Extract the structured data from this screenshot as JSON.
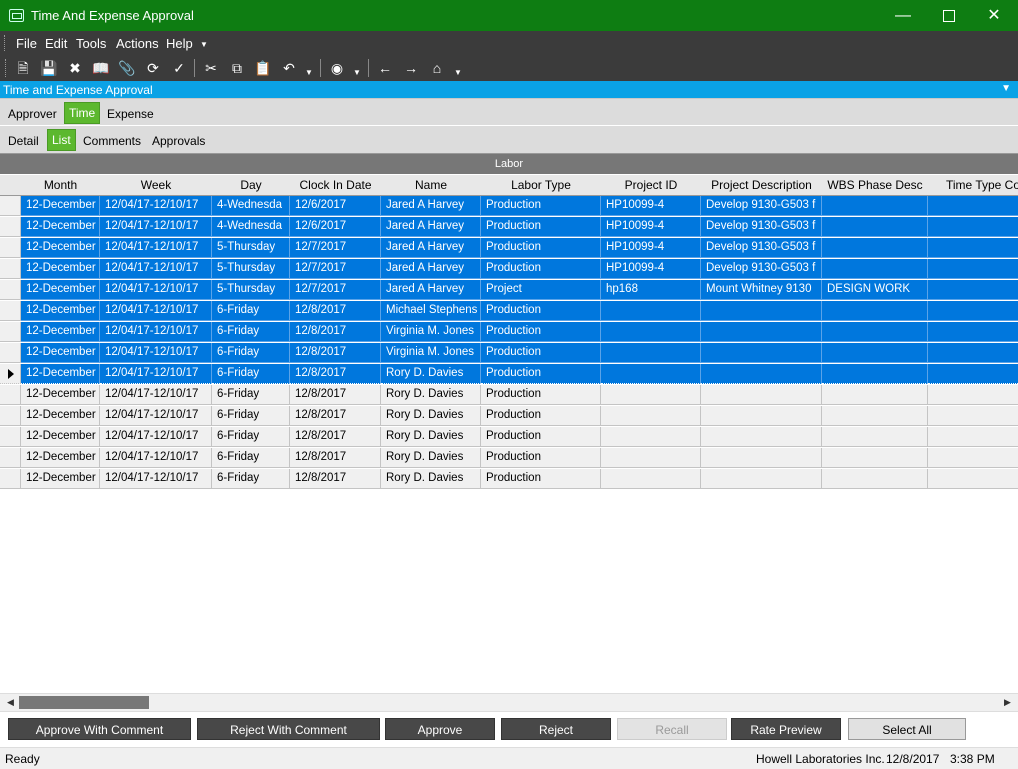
{
  "window": {
    "title": "Time And Expense Approval"
  },
  "menu": [
    "File",
    "Edit",
    "Tools",
    "Actions",
    "Help"
  ],
  "toolbar_icons": [
    "new-icon",
    "save-icon",
    "delete-icon",
    "book-icon",
    "attach-icon",
    "refresh-icon",
    "clear-icon",
    "cut-icon",
    "copy-icon",
    "paste-icon",
    "undo-icon",
    "binoculars-icon",
    "back-icon",
    "forward-icon",
    "home-icon"
  ],
  "doc_title": "Time and Expense Approval",
  "tabs_top": [
    "Approver",
    "Time",
    "Expense"
  ],
  "tabs_sub": [
    "Detail",
    "List",
    "Comments",
    "Approvals"
  ],
  "grid": {
    "group_header": "Labor",
    "columns": [
      "Month",
      "Week",
      "Day",
      "Clock In Date",
      "Name",
      "Labor Type",
      "Project ID",
      "Project Description",
      "WBS Phase Desc",
      "Time Type Co"
    ],
    "rows": [
      {
        "selected": true,
        "cells": [
          "12-December",
          "12/04/17-12/10/17",
          "4-Wednesda",
          "12/6/2017",
          "Jared A Harvey",
          "Production",
          "HP10099-4",
          "Develop 9130-G503 f",
          ""
        ]
      },
      {
        "selected": true,
        "cells": [
          "12-December",
          "12/04/17-12/10/17",
          "4-Wednesda",
          "12/6/2017",
          "Jared A Harvey",
          "Production",
          "HP10099-4",
          "Develop 9130-G503 f",
          ""
        ]
      },
      {
        "selected": true,
        "cells": [
          "12-December",
          "12/04/17-12/10/17",
          "5-Thursday",
          "12/7/2017",
          "Jared A Harvey",
          "Production",
          "HP10099-4",
          "Develop 9130-G503 f",
          ""
        ]
      },
      {
        "selected": true,
        "cells": [
          "12-December",
          "12/04/17-12/10/17",
          "5-Thursday",
          "12/7/2017",
          "Jared A Harvey",
          "Production",
          "HP10099-4",
          "Develop 9130-G503 f",
          ""
        ]
      },
      {
        "selected": true,
        "cells": [
          "12-December",
          "12/04/17-12/10/17",
          "5-Thursday",
          "12/7/2017",
          "Jared A Harvey",
          "Project",
          "hp168",
          "Mount Whitney 9130",
          "DESIGN WORK"
        ]
      },
      {
        "selected": true,
        "cells": [
          "12-December",
          "12/04/17-12/10/17",
          "6-Friday",
          "12/8/2017",
          "Michael Stephens",
          "Production",
          "",
          "",
          ""
        ]
      },
      {
        "selected": true,
        "cells": [
          "12-December",
          "12/04/17-12/10/17",
          "6-Friday",
          "12/8/2017",
          "Virginia M. Jones",
          "Production",
          "",
          "",
          ""
        ]
      },
      {
        "selected": true,
        "cells": [
          "12-December",
          "12/04/17-12/10/17",
          "6-Friday",
          "12/8/2017",
          "Virginia M. Jones",
          "Production",
          "",
          "",
          ""
        ]
      },
      {
        "selected": true,
        "current": true,
        "cells": [
          "12-December",
          "12/04/17-12/10/17",
          "6-Friday",
          "12/8/2017",
          "Rory D. Davies",
          "Production",
          "",
          "",
          ""
        ]
      },
      {
        "selected": false,
        "cells": [
          "12-December",
          "12/04/17-12/10/17",
          "6-Friday",
          "12/8/2017",
          "Rory D. Davies",
          "Production",
          "",
          "",
          ""
        ]
      },
      {
        "selected": false,
        "cells": [
          "12-December",
          "12/04/17-12/10/17",
          "6-Friday",
          "12/8/2017",
          "Rory D. Davies",
          "Production",
          "",
          "",
          ""
        ]
      },
      {
        "selected": false,
        "cells": [
          "12-December",
          "12/04/17-12/10/17",
          "6-Friday",
          "12/8/2017",
          "Rory D. Davies",
          "Production",
          "",
          "",
          ""
        ]
      },
      {
        "selected": false,
        "cells": [
          "12-December",
          "12/04/17-12/10/17",
          "6-Friday",
          "12/8/2017",
          "Rory D. Davies",
          "Production",
          "",
          "",
          ""
        ]
      },
      {
        "selected": false,
        "cells": [
          "12-December",
          "12/04/17-12/10/17",
          "6-Friday",
          "12/8/2017",
          "Rory D. Davies",
          "Production",
          "",
          "",
          ""
        ]
      }
    ]
  },
  "buttons": [
    {
      "label": "Approve With Comment",
      "state": "normal"
    },
    {
      "label": "Reject With Comment",
      "state": "normal"
    },
    {
      "label": "Approve",
      "state": "normal"
    },
    {
      "label": "Reject",
      "state": "normal"
    },
    {
      "label": "Recall",
      "state": "disabled"
    },
    {
      "label": "Rate Preview",
      "state": "normal"
    },
    {
      "label": "Select All",
      "state": "light"
    }
  ],
  "status": {
    "text": "Ready",
    "company": "Howell Laboratories Inc.",
    "date": "12/8/2017",
    "time": "3:38 PM"
  },
  "colors": {
    "titlebar": "#0e7d12",
    "doc_title": "#0aa2e6",
    "active_tab": "#5cb82e",
    "selection": "#0077dd"
  }
}
